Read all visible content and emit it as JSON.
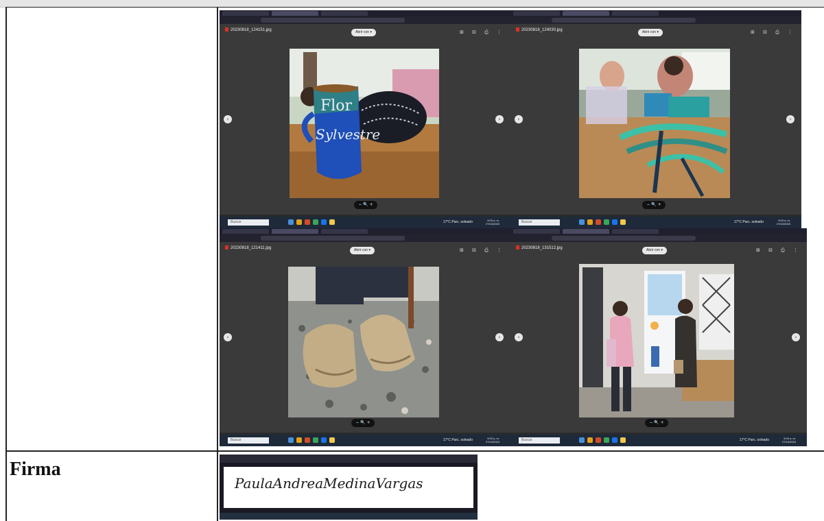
{
  "firma": {
    "label": "Firma"
  },
  "screenshots": [
    {
      "filename": "20230818_124151.jpg",
      "open_with": "Abrir con ▾",
      "tools": "⊞ ⊟ ⎙ ⋮",
      "search": "Buscar",
      "weather": "17°C  Parc. soleado",
      "time": "9:03 a. m.",
      "date": "27/10/2023"
    },
    {
      "filename": "20230818_124030.jpg",
      "open_with": "Abrir con ▾",
      "tools": "⊞ ⊟ ⎙ ⋮",
      "search": "Buscar",
      "weather": "17°C  Parc. soleado",
      "time": "9:03 a. m.",
      "date": "27/10/2023"
    },
    {
      "filename": "20230818_121411.jpg",
      "open_with": "Abrir con ▾",
      "tools": "⊞ ⊟ ⎙ ⋮",
      "search": "Buscar",
      "weather": "17°C  Parc. soleado",
      "time": "9:03 a. m.",
      "date": "27/10/2023"
    },
    {
      "filename": "20230818_131512.jpg",
      "open_with": "Abrir con ▾",
      "tools": "⊞ ⊟ ⎙ ⋮",
      "search": "Buscar",
      "weather": "17°C  Parc. soleado",
      "time": "9:03 a. m.",
      "date": "27/10/2023"
    }
  ],
  "signature": {
    "text": "PaulaAndreaMedinaVargas"
  }
}
